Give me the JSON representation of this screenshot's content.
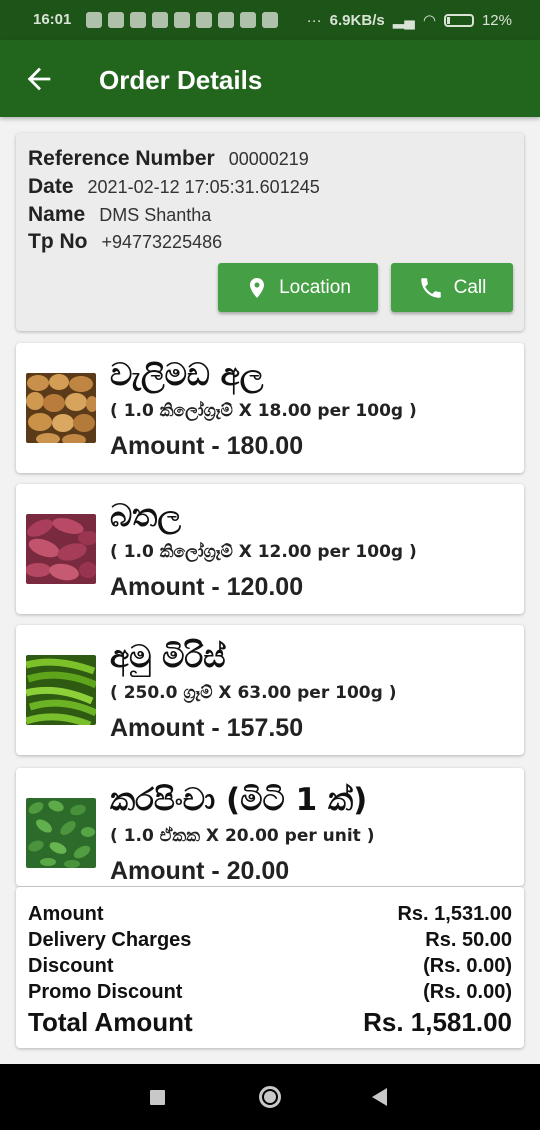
{
  "status": {
    "time": "16:01",
    "speed": "6.9KB/s",
    "battery": "12%"
  },
  "appbar": {
    "title": "Order Details",
    "back_icon": "arrow-back-icon"
  },
  "order": {
    "reference_label": "Reference Number",
    "reference_value": "00000219",
    "date_label": "Date",
    "date_value": "2021-02-12 17:05:31.601245",
    "name_label": "Name",
    "name_value": "DMS Shantha",
    "tp_label": "Tp No",
    "tp_value": "+94773225486",
    "location_label": "Location",
    "call_label": "Call"
  },
  "items": [
    {
      "name": "වැලිමඩ අල",
      "qty": "( 1.0 කිලෝග්‍රෑම් X 18.00 per 100g )",
      "amount": "Amount - 180.00"
    },
    {
      "name": "බතල",
      "qty": "( 1.0 කිලෝග්‍රෑම් X 12.00 per 100g )",
      "amount": "Amount - 120.00"
    },
    {
      "name": "අමු මිරිස්",
      "qty": "( 250.0 ග්‍රෑම් X 63.00 per 100g )",
      "amount": "Amount - 157.50"
    },
    {
      "name": "කරපිංචා (මිටි 1 ක්)",
      "qty": "( 1.0 ඒකක X 20.00 per unit )",
      "amount": "Amount - 20.00"
    }
  ],
  "summary": {
    "amount_label": "Amount",
    "amount_value": "Rs. 1,531.00",
    "delivery_label": "Delivery Charges",
    "delivery_value": "Rs. 50.00",
    "discount_label": "Discount",
    "discount_value": "(Rs. 0.00)",
    "promo_label": "Promo Discount",
    "promo_value": "(Rs. 0.00)",
    "total_label": "Total Amount",
    "total_value": "Rs. 1,581.00"
  },
  "colors": {
    "appbar": "#22651c",
    "button": "#45a045"
  }
}
